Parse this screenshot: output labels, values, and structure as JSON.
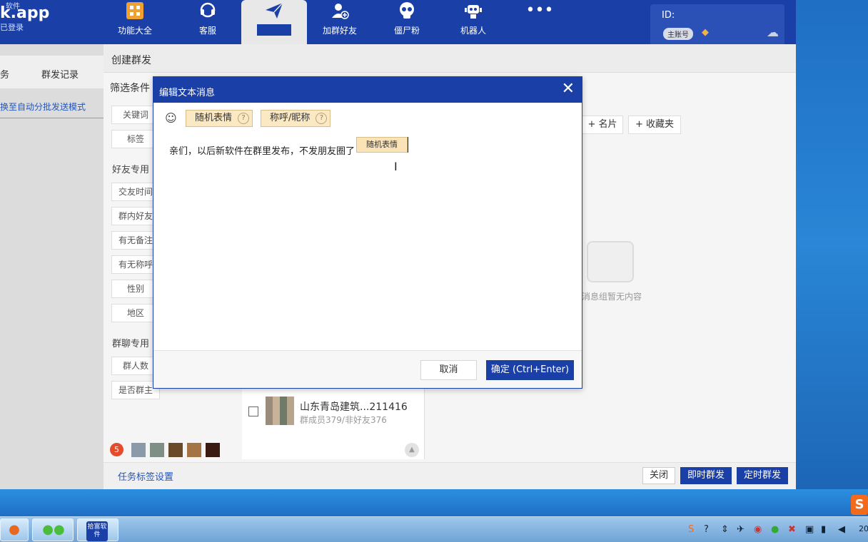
{
  "app": {
    "brand": "k.app",
    "brand_top": "软件",
    "brand_sub": "已登录",
    "nav": [
      {
        "label": "功能大全",
        "icon": "grid-icon"
      },
      {
        "label": "客服",
        "icon": "headset-icon"
      },
      {
        "label": "",
        "icon": "paper-plane-icon"
      },
      {
        "label": "加群好友",
        "icon": "add-user-icon"
      },
      {
        "label": "僵尸粉",
        "icon": "skull-icon"
      },
      {
        "label": "机器人",
        "icon": "robot-icon"
      },
      {
        "label": "",
        "icon": "more-icon"
      }
    ],
    "account": {
      "id_label": "ID:",
      "badge": "主账号"
    }
  },
  "left": {
    "tab_partial": "务",
    "tab_records": "群发记录",
    "auto_link": "换至自动分批发送模式"
  },
  "main": {
    "title": "创建群发",
    "filter_title": "筛选条件",
    "filters_top": [
      "关键词",
      "标签"
    ],
    "friend_section": "好友专用",
    "friend_filters": [
      "交友时间",
      "群内好友",
      "有无备注",
      "有无称呼",
      "性别",
      "地区"
    ],
    "group_section": "群聊专用",
    "group_filters": [
      "群人数",
      "是否群主"
    ],
    "right_buttons": [
      "+ 名片",
      "+ 收藏夹"
    ],
    "empty_text": "消息组暂无内容",
    "group_item": {
      "name": "山东青岛建筑...211416",
      "sub": "群成员379/非好友376"
    },
    "selected_count": "5",
    "task_link": "任务标签设置",
    "footer": {
      "close": "关闭",
      "send_now": "即时群发",
      "send_timed": "定时群发"
    }
  },
  "dialog": {
    "title": "编辑文本消息",
    "chips": [
      "随机表情",
      "称呼/昵称"
    ],
    "help": "?",
    "text": "亲们，以后新软件在群里发布，不发朋友圈了",
    "inline_chip": "随机表情",
    "cancel": "取消",
    "ok": "确定 (Ctrl+Enter)"
  },
  "taskbar": {
    "shiwu_label": "拾富软件",
    "clock_partial": "20"
  }
}
